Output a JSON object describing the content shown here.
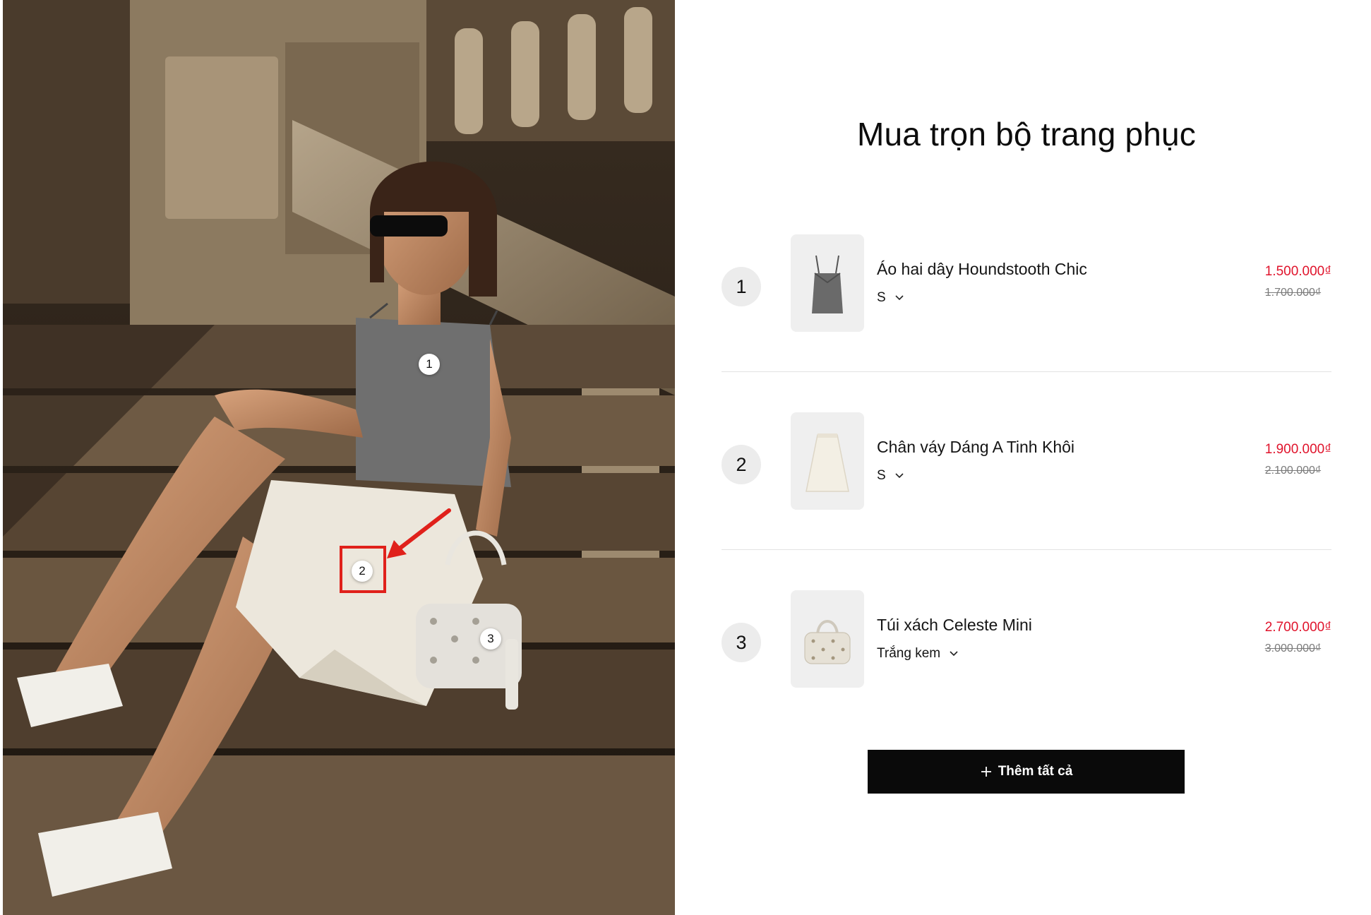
{
  "lookbook": {
    "hotspots": [
      {
        "number": "1"
      },
      {
        "number": "2"
      },
      {
        "number": "3"
      }
    ]
  },
  "panel": {
    "title": "Mua trọn bộ trang phục",
    "items": [
      {
        "number": "1",
        "thumb_icon": "camisole-thumbnail",
        "name": "Áo hai dây Houndstooth Chic",
        "variant": "S",
        "price": "1.500.000₫",
        "original_price": "1.700.000₫"
      },
      {
        "number": "2",
        "thumb_icon": "skirt-thumbnail",
        "name": "Chân váy Dáng A Tinh Khôi",
        "variant": "S",
        "price": "1.900.000₫",
        "original_price": "2.100.000₫"
      },
      {
        "number": "3",
        "thumb_icon": "handbag-thumbnail",
        "name": "Túi xách Celeste Mini",
        "variant": "Trắng kem",
        "price": "2.700.000₫",
        "original_price": "3.000.000₫"
      }
    ],
    "add_all_label": "Thêm tất cả"
  },
  "colors": {
    "sale_price": "#e0132b",
    "button_bg": "#0a0a0a",
    "highlight": "#e0211b"
  }
}
